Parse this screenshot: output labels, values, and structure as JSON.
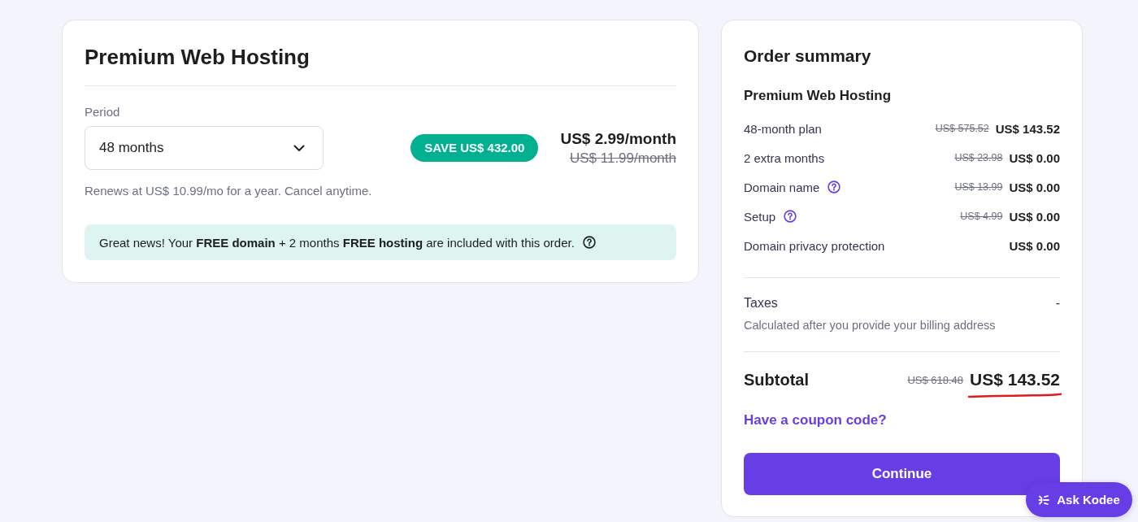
{
  "product_card": {
    "title": "Premium Web Hosting",
    "period": {
      "label": "Period",
      "value": "48 months"
    },
    "save_badge": "SAVE US$ 432.00",
    "price": "US$ 2.99/month",
    "old_price": "US$ 11.99/month",
    "renewal_note": "Renews at US$ 10.99/mo for a year. Cancel anytime.",
    "info_banner": "Great news! Your **FREE domain** + 2 months **FREE hosting** are included with this order."
  },
  "order_summary": {
    "title": "Order summary",
    "product": "Premium Web Hosting",
    "lines": [
      {
        "label": "48-month plan",
        "help": false,
        "old_price": "US$ 575.52",
        "price": "US$ 143.52"
      },
      {
        "label": "2 extra months",
        "help": false,
        "old_price": "US$ 23.98",
        "price": "US$ 0.00"
      },
      {
        "label": "Domain name",
        "help": true,
        "old_price": "US$ 13.99",
        "price": "US$ 0.00"
      },
      {
        "label": "Setup",
        "help": true,
        "old_price": "US$ 4.99",
        "price": "US$ 0.00"
      },
      {
        "label": "Domain privacy protection",
        "help": false,
        "price": "US$ 0.00"
      }
    ],
    "taxes": {
      "label": "Taxes",
      "value": "-",
      "note": "Calculated after you provide your billing address"
    },
    "subtotal": {
      "label": "Subtotal",
      "old_price": "US$ 618.48",
      "price": "US$ 143.52",
      "underlined": true
    },
    "coupon_link": "Have a coupon code?",
    "continue_button": "Continue"
  },
  "chat_button": "Ask Kodee"
}
